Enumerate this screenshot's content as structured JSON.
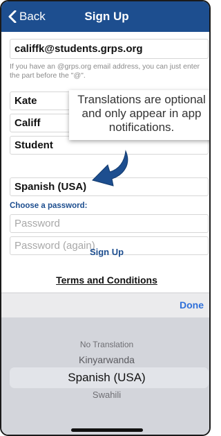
{
  "navbar": {
    "back_label": "Back",
    "title": "Sign Up"
  },
  "form": {
    "email_value": "califfk@students.grps.org",
    "email_hint": "If you have an @grps.org email address, you can just enter the part before the \"@\".",
    "first_name_value": "Kate",
    "last_name_value": "Califf",
    "role_value": "Student",
    "language_value": "Spanish (USA)",
    "password_section_label": "Choose a password:",
    "password_placeholder": "Password",
    "password_again_placeholder": "Password (again)",
    "signup_label": "Sign Up",
    "terms_label": "Terms and Conditions"
  },
  "callout": {
    "lines": [
      "Translations are optional",
      "and only appear in app",
      "notifications."
    ]
  },
  "toolbar": {
    "done_label": "Done"
  },
  "picker": {
    "options": [
      "No Translation",
      "Kinyarwanda",
      "Spanish (USA)",
      "Swahili"
    ],
    "selected": "Spanish (USA)"
  },
  "colors": {
    "navbar_bg": "#1d4e8f",
    "accent_blue": "#1d4e8f",
    "done_blue": "#2e6fd9",
    "picker_bg": "#d3d5db"
  }
}
